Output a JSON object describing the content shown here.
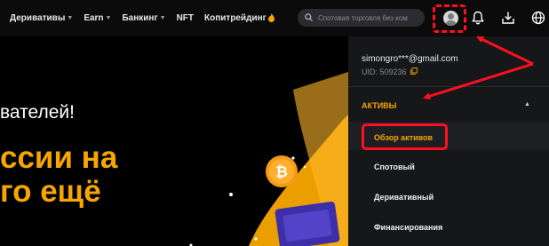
{
  "nav": {
    "items": [
      {
        "label": "Деривативы",
        "caret": "▼"
      },
      {
        "label": "Earn",
        "caret": "▼"
      },
      {
        "label": "Банкинг",
        "caret": "▼"
      },
      {
        "label": "NFT",
        "caret": ""
      },
      {
        "label": "Копитрейдинг",
        "caret": ""
      }
    ],
    "flame_icon": "flame-icon"
  },
  "search": {
    "placeholder": "Спотовая торговля без ком",
    "value": ""
  },
  "icons": [
    "search-icon",
    "avatar-icon",
    "bell-icon",
    "download-icon",
    "globe-icon"
  ],
  "hero": {
    "line1": "вателей!",
    "line2": "ссии на",
    "line3": "го ещё"
  },
  "account": {
    "email": "simongro***@gmail.com",
    "uid": "UID: 509236"
  },
  "assets_menu": {
    "section_label": "АКТИВЫ",
    "items": [
      "Обзор активов",
      "Спотовый",
      "Деривативный",
      "Финансирования"
    ],
    "active_index": 0
  },
  "colors": {
    "accent": "#f7a600",
    "highlight": "#ff0f1f",
    "background": "#000000",
    "dropdown_bg": "#161719"
  }
}
